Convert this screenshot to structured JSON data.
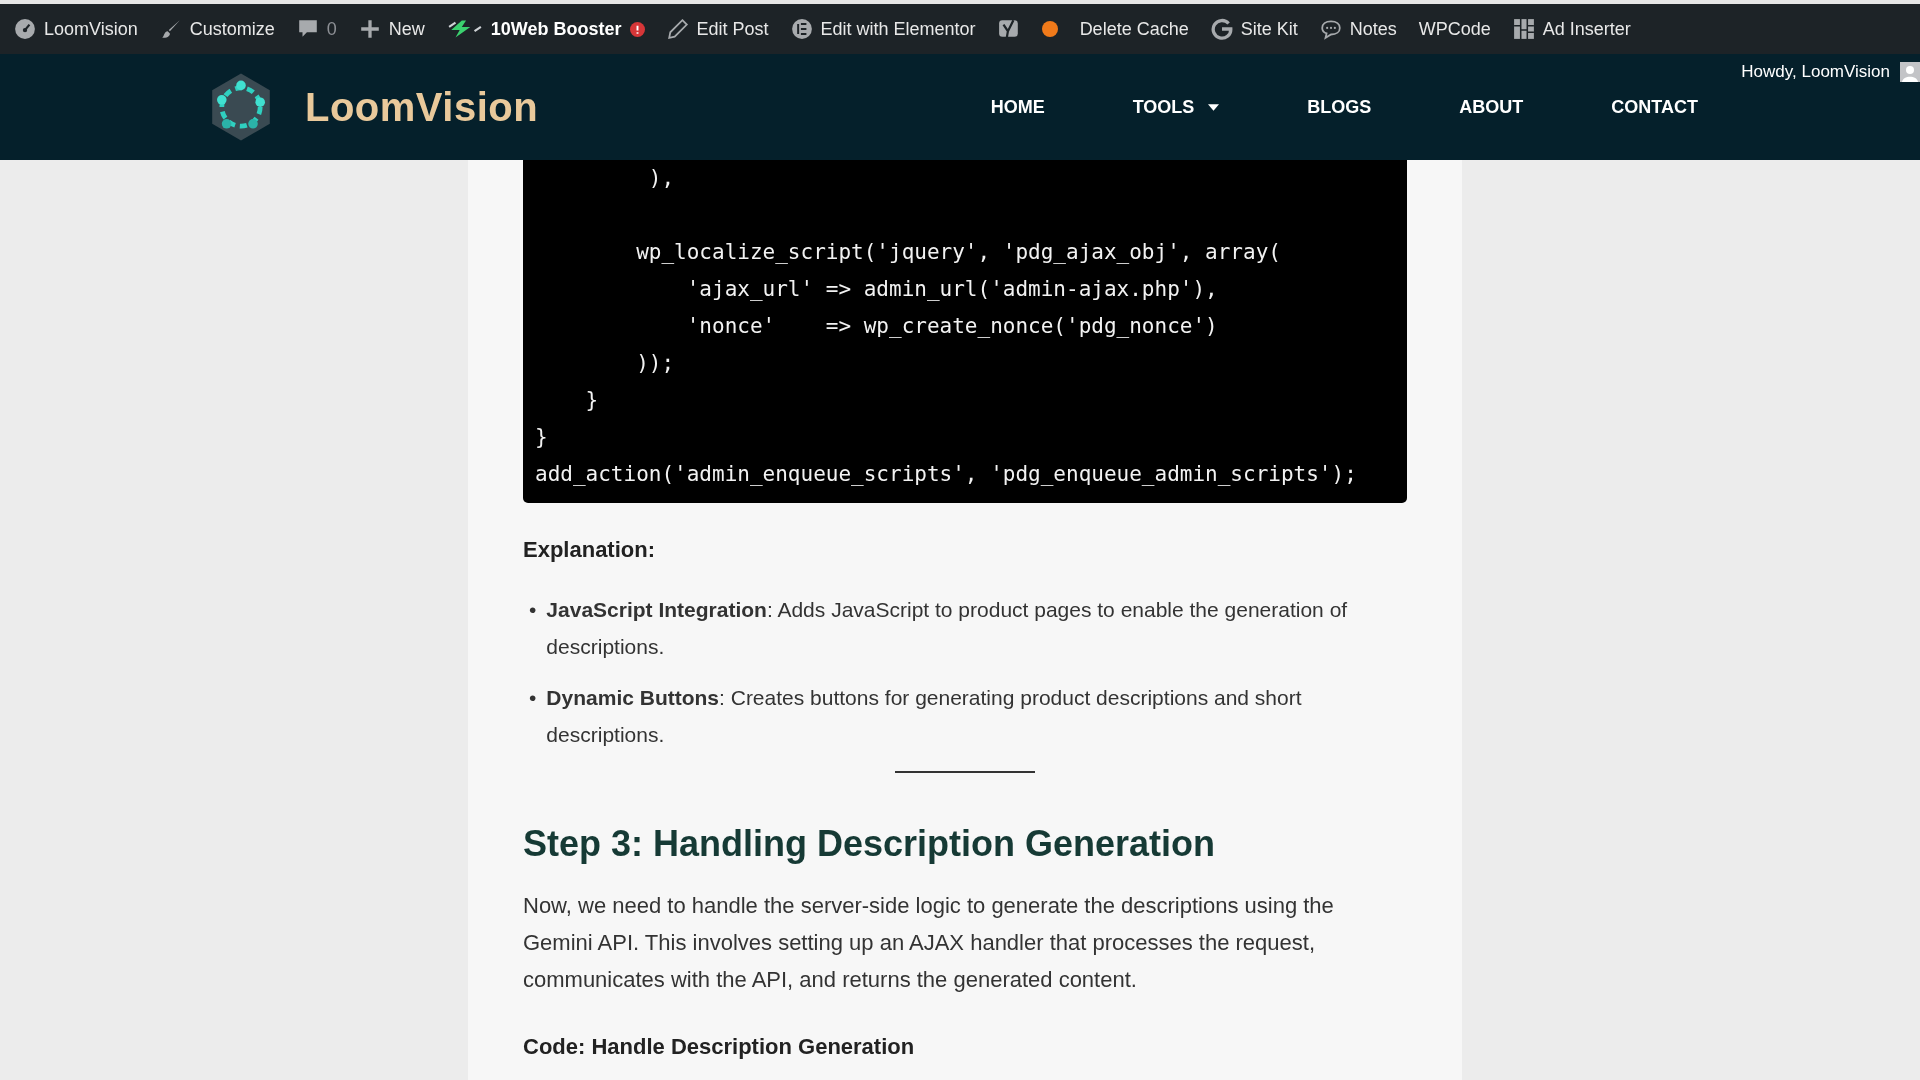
{
  "admin_bar": {
    "items": [
      {
        "kind": "dashboard",
        "label": "LoomVision"
      },
      {
        "kind": "brush",
        "label": "Customize"
      },
      {
        "kind": "comments",
        "label": "0"
      },
      {
        "kind": "new",
        "label": "New"
      },
      {
        "kind": "booster",
        "label": "10Web Booster"
      },
      {
        "kind": "pencil",
        "label": "Edit Post"
      },
      {
        "kind": "elementor",
        "label": "Edit with Elementor"
      },
      {
        "kind": "seo"
      },
      {
        "kind": "dot",
        "color": "#f07a1a"
      },
      {
        "kind": "plain",
        "label": "Delete Cache"
      },
      {
        "kind": "google",
        "label": "Site Kit"
      },
      {
        "kind": "notes",
        "label": "Notes"
      },
      {
        "kind": "plain",
        "label": "WPCode"
      },
      {
        "kind": "grid",
        "label": "Ad Inserter"
      }
    ],
    "account": "Howdy, LoomVision"
  },
  "header": {
    "logo": "LoomVision",
    "nav": [
      {
        "label": "HOME",
        "dropdown": false
      },
      {
        "label": "TOOLS",
        "dropdown": true
      },
      {
        "label": "BLOGS",
        "dropdown": false
      },
      {
        "label": "ABOUT",
        "dropdown": false
      },
      {
        "label": "CONTACT",
        "dropdown": false
      }
    ]
  },
  "article": {
    "code": "         ),\n\n        wp_localize_script('jquery', 'pdg_ajax_obj', array(\n            'ajax_url' => admin_url('admin-ajax.php'),\n            'nonce'    => wp_create_nonce('pdg_nonce')\n        ));\n    }\n}\nadd_action('admin_enqueue_scripts', 'pdg_enqueue_admin_scripts');",
    "explanation_heading": "Explanation:",
    "bullets": [
      {
        "marker": "•",
        "text": "**JavaScript Integration**: Adds JavaScript to product pages to enable the generation of descriptions."
      },
      {
        "marker": "•",
        "text": "**Dynamic Buttons**: Creates buttons for generating product descriptions and short descriptions."
      }
    ],
    "step_heading": "Step 3: Handling Description Generation",
    "paragraph": "Now, we need to handle the server-side logic to generate the descriptions using the Gemini API. This involves setting up an AJAX handler that processes the request, communicates with the API, and returns the generated content.",
    "code_heading": "Code: Handle Description Generation"
  }
}
